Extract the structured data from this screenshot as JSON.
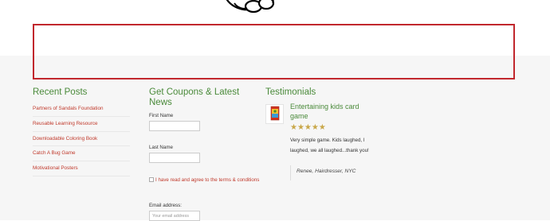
{
  "recent_posts": {
    "title": "Recent Posts",
    "items": [
      "Partners of Sandals Foundation",
      "Reusable Learning Resource",
      "Downloadable Coloring Book",
      "Catch A Bug Game",
      "Motivational Posters"
    ]
  },
  "coupons": {
    "title": "Get Coupons & Latest News",
    "first_name_label": "First Name",
    "last_name_label": "Last Name",
    "terms_text": "I have read and agree to the terms & conditions",
    "email_label": "Email address:",
    "email_placeholder": "Your email address"
  },
  "testimonials": {
    "title": "Testimonials",
    "product_title": "Entertaining kids card game",
    "rating": 5,
    "stars": "★★★★★",
    "review": "Very simple game. Kids laughed, I laughed, we all laughed...thank you!",
    "author": "Renee, Hairdresser, NYC"
  },
  "colors": {
    "accent_green": "#4a8a3a",
    "link_red": "#c0392b",
    "ad_border_red": "#c1272d",
    "star_gold": "#c9a84a"
  }
}
